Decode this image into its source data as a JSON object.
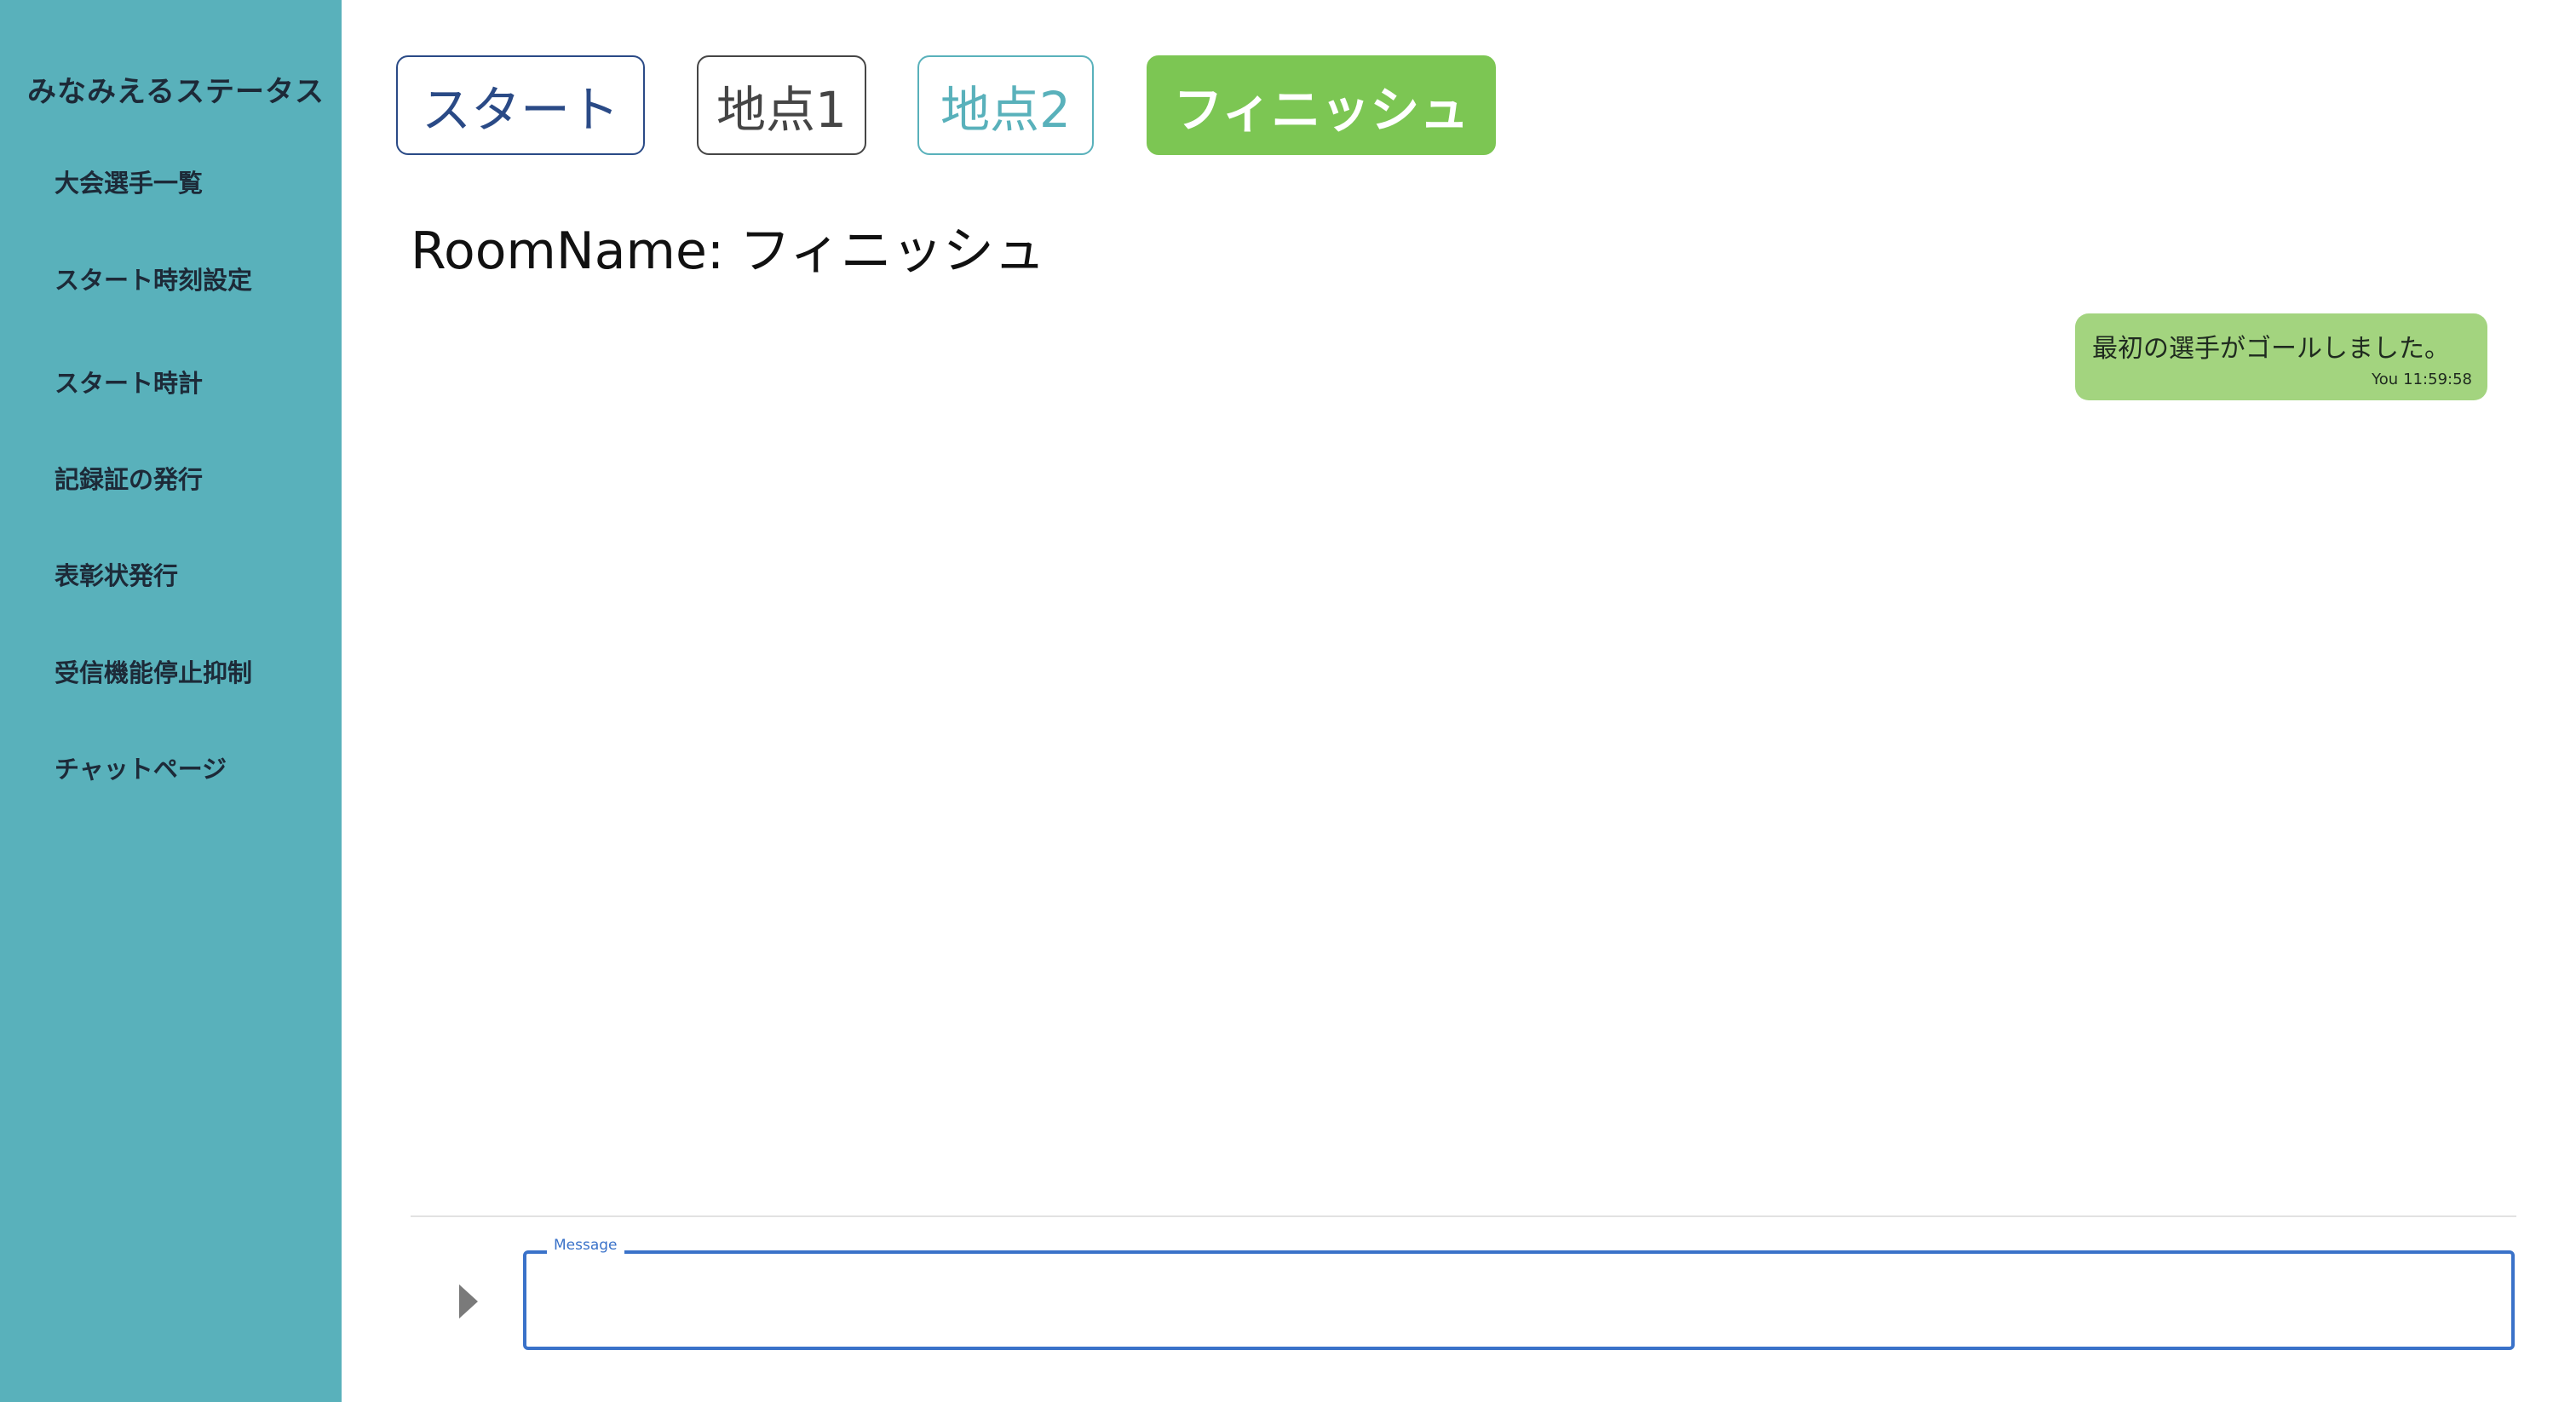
{
  "sidebar": {
    "title": "みなみえるステータス",
    "items": [
      {
        "label": "大会選手一覧"
      },
      {
        "label": "スタート時刻設定"
      },
      {
        "label": "スタート時計"
      },
      {
        "label": "記録証の発行"
      },
      {
        "label": "表彰状発行"
      },
      {
        "label": "受信機能停止抑制"
      },
      {
        "label": "チャットページ"
      }
    ]
  },
  "tabs": [
    {
      "label": "スタート"
    },
    {
      "label": "地点1"
    },
    {
      "label": "地点2"
    },
    {
      "label": "フィニッシュ",
      "active": true
    }
  ],
  "room": {
    "label": "RoomName:",
    "name": "フィニッシュ"
  },
  "messages": [
    {
      "text": "最初の選手がゴールしました。",
      "sender": "You",
      "time": "11:59:58"
    }
  ],
  "composer": {
    "field_label": "Message",
    "value": ""
  },
  "colors": {
    "sidebar_bg": "#59b1bb",
    "active_tab": "#7cc653",
    "bubble": "#a3d47f",
    "input_border": "#3a72c9"
  }
}
